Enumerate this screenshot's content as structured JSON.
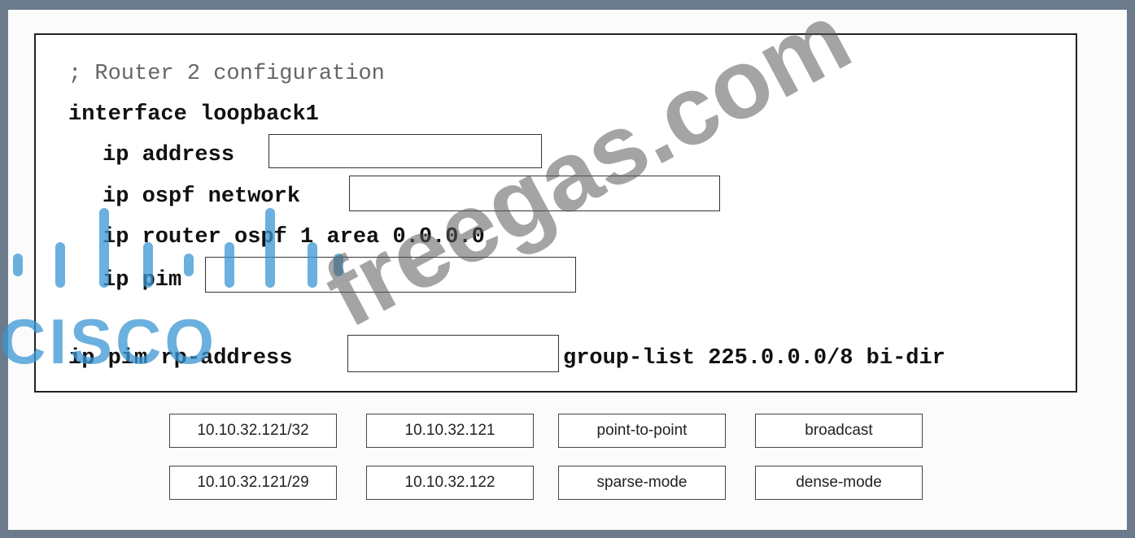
{
  "config": {
    "comment": "; Router 2 configuration",
    "interface_line": "interface loopback1",
    "ip_address_label": "ip address",
    "ospf_network_label": "ip ospf network",
    "ospf_area_line": "ip router ospf 1 area 0.0.0.0",
    "pim_label": "ip pim",
    "rp_address_label": "ip pim rp-address",
    "group_list_suffix": "group-list 225.0.0.0/8 bi-dir"
  },
  "options": [
    "10.10.32.121/32",
    "10.10.32.121",
    "point-to-point",
    "broadcast",
    "10.10.32.121/29",
    "10.10.32.122",
    "sparse-mode",
    "dense-mode"
  ],
  "logo_text": "CISCO",
  "watermark": "freegas.com"
}
